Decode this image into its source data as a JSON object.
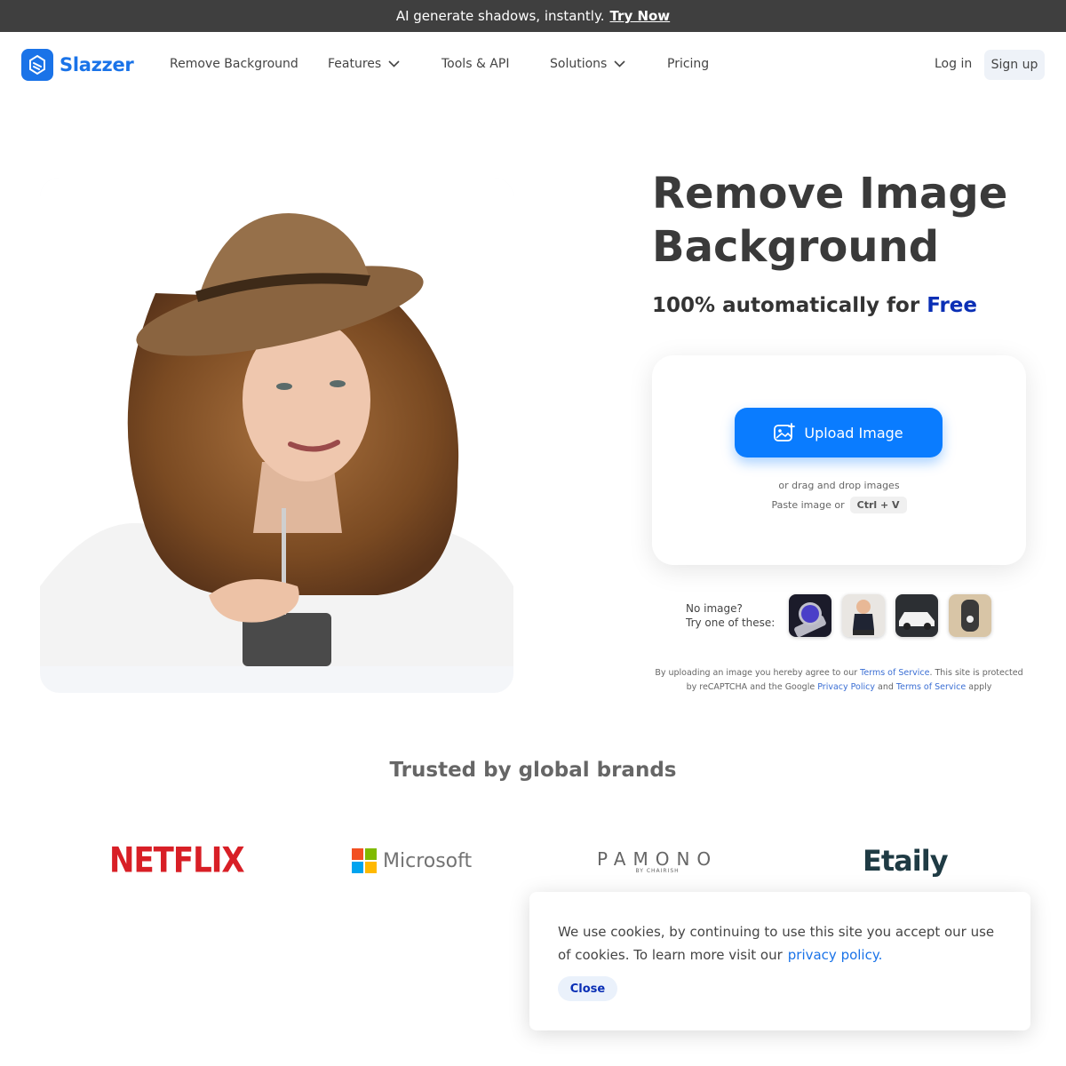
{
  "banner": {
    "text": "AI generate shadows, instantly.",
    "link": "Try Now"
  },
  "brand": {
    "name": "Slazzer",
    "color": "#1a73e8"
  },
  "nav": {
    "items": [
      {
        "label": "Remove Background",
        "has_dropdown": false
      },
      {
        "label": "Features",
        "has_dropdown": true
      },
      {
        "label": "Tools & API",
        "has_dropdown": false
      },
      {
        "label": "Solutions",
        "has_dropdown": true
      },
      {
        "label": "Pricing",
        "has_dropdown": false
      }
    ],
    "login": "Log in",
    "signup": "Sign up"
  },
  "hero": {
    "title_line1": "Remove Image",
    "title_line2": "Background",
    "subtitle_prefix": "100% automatically for",
    "subtitle_highlight": "Free",
    "highlight_color": "#0a2fb5"
  },
  "upload": {
    "button_label": "Upload Image",
    "button_color": "#0a7cff",
    "drag_text": "or drag and drop images",
    "paste_text": "Paste image or",
    "shortcut": "Ctrl + V"
  },
  "samples": {
    "prompt_line1": "No image?",
    "prompt_line2": "Try one of these:",
    "items": [
      "watch",
      "baby",
      "car",
      "shoe"
    ]
  },
  "legal": {
    "t1": "By uploading an image you hereby agree to our",
    "terms1": "Terms of Service",
    "t2": ". This site is protected by reCAPTCHA and the Google",
    "privacy": "Privacy Policy",
    "t3": "and",
    "terms2": "Terms of Service",
    "t4": "apply"
  },
  "trusted": {
    "heading": "Trusted by global brands",
    "brands": {
      "netflix": "NETFLIX",
      "microsoft": "Microsoft",
      "pamono": "PAMONO",
      "pamono_sub": "BY CHAIRISH",
      "etaily": "Etaily"
    }
  },
  "cookie": {
    "text": "We use cookies, by continuing to use this site you accept our use of cookies.  To learn more visit our",
    "link": "privacy policy.",
    "close": "Close"
  }
}
